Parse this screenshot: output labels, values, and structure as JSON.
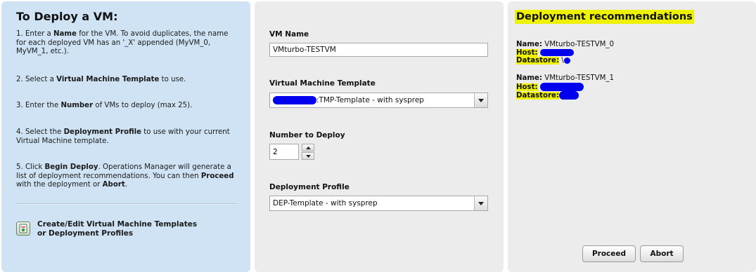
{
  "instructions": {
    "title": "To Deploy a VM:",
    "step1_a": "1. Enter a ",
    "step1_b": "Name",
    "step1_c": " for the VM. To avoid duplicates, the name for each deployed VM has an '_X' appended (MyVM_0, MyVM_1, etc.).",
    "step2_a": "2. Select a ",
    "step2_b": "Virtual Machine Template",
    "step2_c": " to use.",
    "step3_a": "3. Enter the ",
    "step3_b": "Number",
    "step3_c": " of VMs to deploy (max 25).",
    "step4_a": "4. Select the ",
    "step4_b": "Deployment Profile",
    "step4_c": " to use with your current Virtual Machine template.",
    "step5_a": "5. Click ",
    "step5_b": "Begin Deploy",
    "step5_c": ". Operations Manager will generate a list of deployment recommendations. You can then ",
    "step5_d": "Proceed",
    "step5_e": " with the deployment or ",
    "step5_f": "Abort",
    "step5_g": ".",
    "link_line1": "Create/Edit Virtual Machine Templates",
    "link_line2": "or Deployment Profiles"
  },
  "form": {
    "vm_name_label": "VM Name",
    "vm_name_value": "VMturbo-TESTVM",
    "template_label": "Virtual Machine Template",
    "template_value": ":TMP-Template - with sysprep",
    "number_label": "Number to Deploy",
    "number_value": "2",
    "profile_label": "Deployment Profile",
    "profile_value": "DEP-Template - with sysprep"
  },
  "recommendations": {
    "title": "Deployment recommendations",
    "items": [
      {
        "name_label": "Name:",
        "name_value": " VMturbo-TESTVM_0",
        "host_label": "Host:",
        "datastore_label": "Datastore:",
        "datastore_suffix": "\\"
      },
      {
        "name_label": "Name:",
        "name_value": " VMturbo-TESTVM_1",
        "host_label": "Host:",
        "datastore_label": "Datastore:",
        "datastore_suffix": ""
      }
    ],
    "proceed_label": "Proceed",
    "abort_label": "Abort"
  },
  "icons": {
    "template_link": "template-edit-icon",
    "dropdown": "chevron-down-icon",
    "stepper_up": "stepper-up-icon",
    "stepper_down": "stepper-down-icon"
  },
  "colors": {
    "left_panel_bg": "#cfe3f5",
    "panel_bg": "#ececec",
    "highlight": "#eef200",
    "redaction": "#0000ee"
  }
}
